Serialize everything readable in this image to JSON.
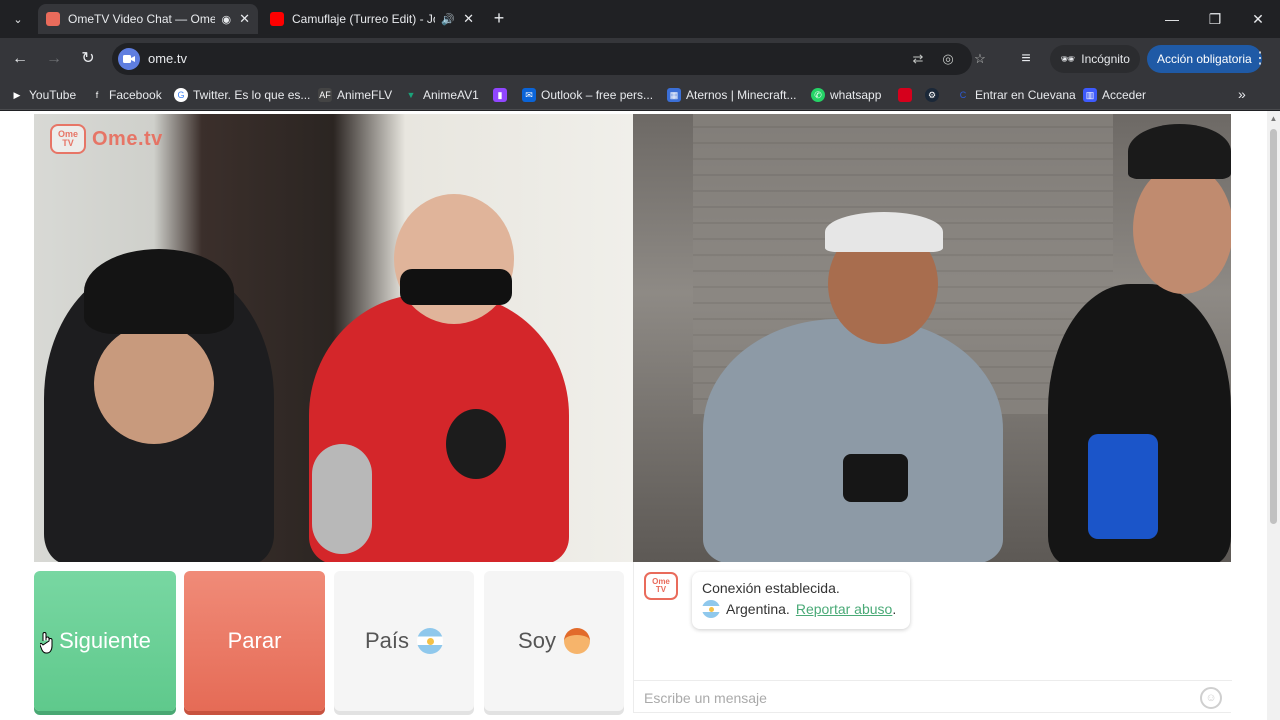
{
  "browser": {
    "tabs": [
      {
        "title": "OmeTV Video Chat — Ome",
        "state": "recording",
        "close": "✕"
      },
      {
        "title": "Camuflaje (Turreo Edit) - Jo",
        "state": "audio",
        "close": "✕"
      }
    ],
    "new_tab": "+",
    "window": {
      "minimize": "—",
      "maximize": "❐",
      "close": "✕"
    },
    "url": "ome.tv",
    "incognito_label": "Incógnito",
    "action_button": "Acción obligatoria",
    "bookmarks": [
      {
        "label": "YouTube",
        "color": "#ff0000",
        "icon": "youtube-icon"
      },
      {
        "label": "Facebook",
        "color": "#1877f2",
        "icon": "facebook-icon"
      },
      {
        "label": "Twitter. Es lo que es...",
        "color": "#ffffff",
        "icon": "google-icon"
      },
      {
        "label": "AnimeFLV",
        "color": "#333333",
        "icon": "animeflv-icon"
      },
      {
        "label": "AnimeAV1",
        "color": "#1aa37a",
        "icon": "animeav1-icon"
      },
      {
        "label": "",
        "color": "#9146ff",
        "icon": "twitch-icon"
      },
      {
        "label": "Outlook – free pers...",
        "color": "#0a64d8",
        "icon": "outlook-icon"
      },
      {
        "label": "Aternos | Minecraft...",
        "color": "#3b6fd6",
        "icon": "aternos-icon"
      },
      {
        "label": "whatsapp",
        "color": "#25d366",
        "icon": "whatsapp-icon"
      },
      {
        "label": "",
        "color": "#d6001c",
        "icon": "bookmark-red-icon"
      },
      {
        "label": "",
        "color": "#1b2838",
        "icon": "steam-icon"
      },
      {
        "label": "Entrar en Cuevana",
        "color": "#2d5bd6",
        "icon": "cuevana-icon"
      },
      {
        "label": "Acceder",
        "color": "#3d5afe",
        "icon": "acceder-icon"
      }
    ]
  },
  "ometv": {
    "logo_text": "Ome.tv",
    "logo_badge": "Ome TV",
    "buttons": {
      "next": "Siguiente",
      "stop": "Parar",
      "country": "País",
      "gender": "Soy"
    },
    "chat": {
      "status": "Conexión establecida.",
      "country": "Argentina.",
      "report_link": "Reportar abuso",
      "report_suffix": ".",
      "input_placeholder": "Escribe un mensaje"
    }
  }
}
